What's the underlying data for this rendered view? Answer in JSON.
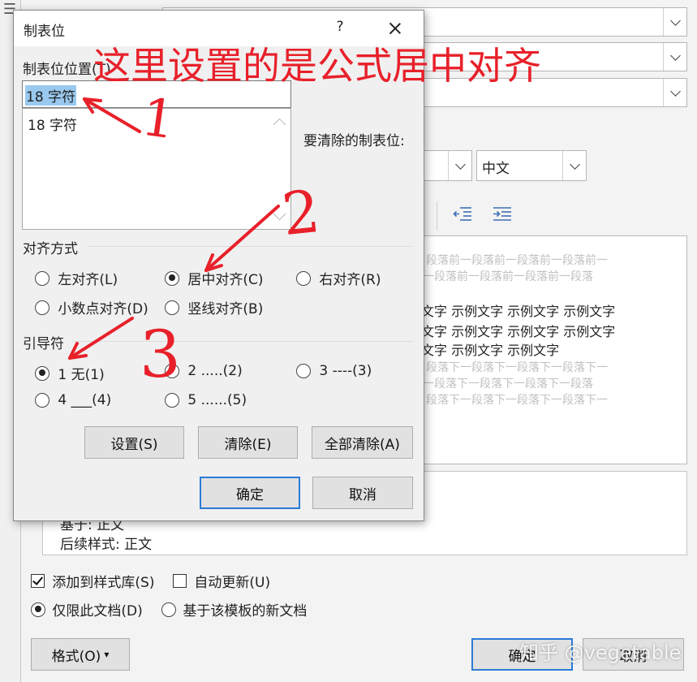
{
  "background_dialog": {
    "font_family_value": "中文",
    "preview": {
      "prev_para_lines": [
        "段落前一段落前一段落前一段落前一",
        "一段落前一段落前一段落前一段落"
      ],
      "sample_lines": [
        "文字  示例文字  示例文字  示例文字",
        "文字  示例文字  示例文字  示例文字",
        "文字  示例文字  示例文字"
      ],
      "next_para_lines": [
        "段落下一段落下一段落下一段落下一",
        "一段落下一段落下一段落下一段落",
        "段落下一段落下一段落下一段落下一"
      ]
    },
    "description": {
      "based_on": "基于: 正文",
      "next_style": "后续样式: 正文"
    },
    "add_to_gallery_label": "添加到样式库(S)",
    "add_to_gallery_checked": true,
    "auto_update_label": "自动更新(U)",
    "auto_update_checked": false,
    "only_this_doc_label": "仅限此文档(D)",
    "new_docs_label": "基于该模板的新文档",
    "format_button": "格式(O)",
    "format_caret": "▾",
    "ok_button": "确定",
    "cancel_button": "取消"
  },
  "tab_dialog": {
    "title": "制表位",
    "help": "?",
    "tab_stop_position_label": "制表位位置(T)",
    "tab_stop_position_value": "18 字符",
    "tab_list_items": [
      "18 字符"
    ],
    "tabs_to_clear_label": "要清除的制表位:",
    "alignment": {
      "label": "对齐方式",
      "options": [
        {
          "label": "左对齐(L)",
          "selected": false
        },
        {
          "label": "居中对齐(C)",
          "selected": true
        },
        {
          "label": "右对齐(R)",
          "selected": false
        },
        {
          "label": "小数点对齐(D)",
          "selected": false
        },
        {
          "label": "竖线对齐(B)",
          "selected": false
        }
      ]
    },
    "leader": {
      "label": "引导符",
      "options": [
        {
          "label": "1 无(1)",
          "selected": true
        },
        {
          "label": "2 .....(2)",
          "selected": false
        },
        {
          "label": "3 ----(3)",
          "selected": false
        },
        {
          "label": "4 ___(4)",
          "selected": false
        },
        {
          "label": "5 ......(5)",
          "selected": false
        }
      ]
    },
    "set_button": "设置(S)",
    "clear_button": "清除(E)",
    "clear_all_button": "全部清除(A)",
    "ok_button": "确定",
    "cancel_button": "取消"
  },
  "annotations": {
    "headline": "这里设置的是公式居中对齐",
    "mark1": "1",
    "mark2": "2",
    "mark3": "3",
    "color": "#e8202a"
  },
  "watermark": "知乎 @vegetable"
}
